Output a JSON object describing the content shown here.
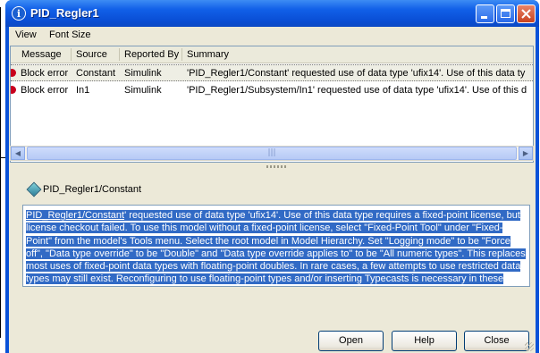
{
  "window": {
    "title": "PID_Regler1",
    "title_icon_glyph": "i",
    "title_icon": "info-icon",
    "controls": [
      "minimize-icon",
      "maximize-icon",
      "close-icon"
    ]
  },
  "menu": [
    "View",
    "Font Size"
  ],
  "table": {
    "columns": [
      "Message",
      "Source",
      "Reported By",
      "Summary"
    ],
    "rows": [
      {
        "message": "Block error",
        "source": "Constant",
        "reported_by": "Simulink",
        "summary": "'PID_Regler1/Constant' requested use of data type 'ufix14'. Use of this data ty",
        "status_icon": "error-icon"
      },
      {
        "message": "Block error",
        "source": "In1",
        "reported_by": "Simulink",
        "summary": "'PID_Regler1/Subsystem/In1' requested use of data type 'ufix14'. Use of this d",
        "status_icon": "error-icon"
      }
    ],
    "scroll_thumb_glyph": "|||"
  },
  "detail": {
    "block_icon": "block-icon",
    "block_name": "PID_Regler1/Constant",
    "link_text": "PID_Regler1/Constant",
    "message_text": "' requested use of data type 'ufix14'. Use of this data type requires a fixed-point license, but license checkout failed. To use this model without a fixed-point license, select \"Fixed-Point Tool\" under \"Fixed-Point\" from the model's Tools menu. Select the root model in Model Hierarchy. Set \"Logging mode\" to be \"Force off\", \"Data type override\" to be \"Double\" and \"Data type override applies to\" to be \"All numeric types\". This replaces most uses of fixed-point data types with floating-point doubles. In rare cases, a few attempts to use restricted data types may still exist. Reconfiguring to use floating-point types and/or inserting Typecasts is necessary in these cases."
  },
  "buttons": {
    "open": "Open",
    "help": "Help",
    "close": "Close"
  },
  "colors": {
    "titlebar": "#0a52d8",
    "selection": "#316ac5",
    "error": "#c8001e"
  }
}
